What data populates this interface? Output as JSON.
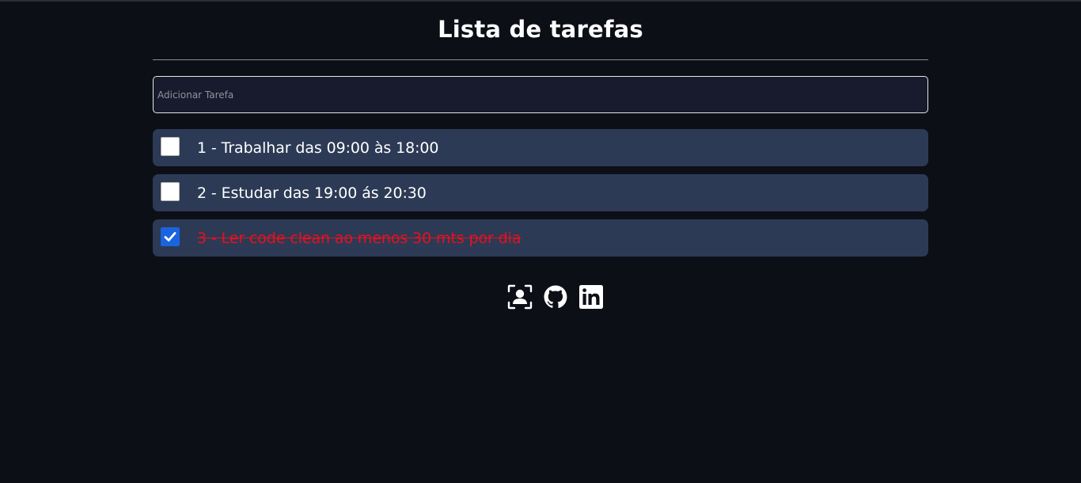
{
  "header": {
    "title": "Lista de tarefas"
  },
  "add_task": {
    "placeholder": "Adicionar Tarefa",
    "value": ""
  },
  "tasks": [
    {
      "label": "1 - Trabalhar das 09:00 às 18:00",
      "checked": false
    },
    {
      "label": "2 - Estudar das 19:00 ás 20:30",
      "checked": false
    },
    {
      "label": "3 - Ler code clean ao menos 30 mts por dia",
      "checked": true
    }
  ],
  "socials": [
    {
      "icon": "portfolio-icon"
    },
    {
      "icon": "github-icon"
    },
    {
      "icon": "linkedin-icon"
    }
  ],
  "colors": {
    "background": "#0c0f16",
    "task_bg": "#2c3a55",
    "done_text": "#e8101d",
    "checkbox_checked": "#1a64e0"
  }
}
